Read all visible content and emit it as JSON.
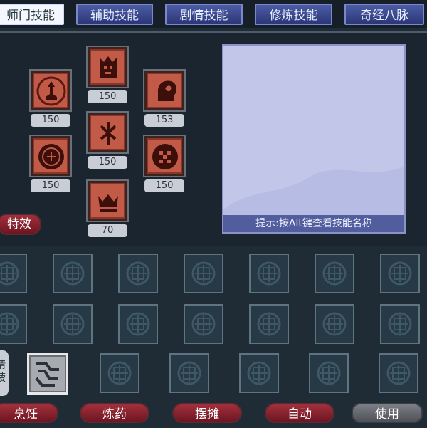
{
  "tabs": [
    {
      "label": "师门技能",
      "active": true
    },
    {
      "label": "辅助技能",
      "active": false
    },
    {
      "label": "剧情技能",
      "active": false
    },
    {
      "label": "修炼技能",
      "active": false
    },
    {
      "label": "奇经八脉",
      "active": false
    }
  ],
  "skills": [
    {
      "icon": "shrine-icon",
      "level": "150"
    },
    {
      "icon": "crowned-mask-icon",
      "level": "150"
    },
    {
      "icon": "leaf-head-icon",
      "level": "153"
    },
    {
      "icon": "round-seal-icon",
      "level": "150"
    },
    {
      "icon": "trident-glyph-icon",
      "level": "150"
    },
    {
      "icon": "dotted-disc-icon",
      "level": "150"
    },
    {
      "icon": "crown-icon",
      "level": "70"
    }
  ],
  "effects_button": "特效",
  "description_hint": "提示:按Alt键查看技能名称",
  "side_text": "请菠",
  "bottom_buttons": [
    {
      "label": "烹饪"
    },
    {
      "label": "炼药"
    },
    {
      "label": "摆摊"
    },
    {
      "label": "自动"
    },
    {
      "label": "使用"
    }
  ],
  "colors": {
    "active_tab": "#f4f7ff",
    "tab": "#3a4890",
    "skill_frame": "#c25a48",
    "hint_bar": "#515d9c",
    "red_button": "#8a2230"
  }
}
